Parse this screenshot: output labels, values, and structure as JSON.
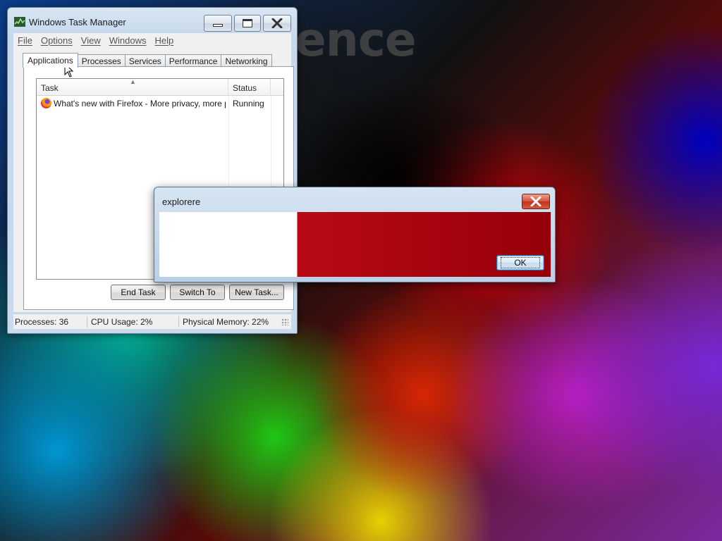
{
  "wallpaper": {
    "text": "ence"
  },
  "task_manager": {
    "title": "Windows Task Manager",
    "menu": [
      "File",
      "Options",
      "View",
      "Windows",
      "Help"
    ],
    "tabs": [
      "Applications",
      "Processes",
      "Services",
      "Performance",
      "Networking"
    ],
    "active_tab": "Applications",
    "columns": {
      "task": "Task",
      "status": "Status"
    },
    "rows": [
      {
        "task": "What's new with Firefox - More privacy, more pr...",
        "status": "Running",
        "icon": "firefox-icon"
      }
    ],
    "buttons": {
      "end_task": "End Task",
      "switch_to": "Switch To",
      "new_task": "New Task..."
    },
    "statusbar": {
      "processes": "Processes: 36",
      "cpu": "CPU Usage: 2%",
      "memory": "Physical Memory: 22%"
    }
  },
  "dialog": {
    "title": "explorere",
    "ok_label": "OK"
  },
  "colors": {
    "titlebar": "#c5d8ec",
    "close_red": "#c0301d",
    "dialog_red": "#b90a14"
  }
}
